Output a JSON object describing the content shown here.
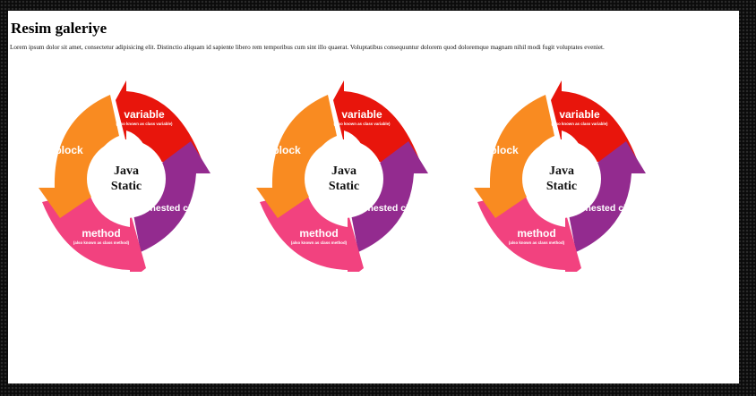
{
  "page": {
    "title": "Resim galeriye",
    "intro": "Lorem ipsum dolor sit amet, consectetur adipisicing elit. Distinctio aliquam id sapiente libero rem temporibus cum sint illo quaerat. Voluptatibus consequuntur dolorem quod doloremque magnam nihil modi fugit voluptates eveniet."
  },
  "gallery": {
    "images": [
      {
        "center_line1": "Java",
        "center_line2": "Static",
        "variable": "variable",
        "variable_note": "(also known as class variable)",
        "block": "block",
        "nested": "nested class",
        "method": "method",
        "method_note": "(also known as class method)"
      },
      {
        "center_line1": "Java",
        "center_line2": "Static",
        "variable": "variable",
        "variable_note": "(also known as class variable)",
        "block": "block",
        "nested": "nested class",
        "method": "method",
        "method_note": "(also known as class method)"
      },
      {
        "center_line1": "Java",
        "center_line2": "Static",
        "variable": "variable",
        "variable_note": "(also known as class variable)",
        "block": "block",
        "nested": "nested class",
        "method": "method",
        "method_note": "(also known as class method)"
      }
    ]
  },
  "colors": {
    "variable": "#e8150c",
    "block": "#f98b21",
    "nested": "#932b8f",
    "method": "#f2427f"
  }
}
